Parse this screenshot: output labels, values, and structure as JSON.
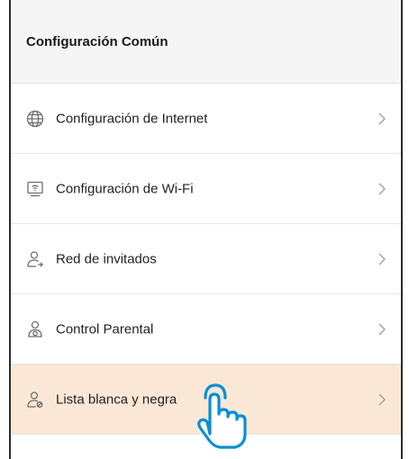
{
  "header": {
    "title": "Configuración Común"
  },
  "menu": {
    "items": [
      {
        "label": "Configuración de Internet",
        "icon": "globe-icon"
      },
      {
        "label": "Configuración de Wi-Fi",
        "icon": "wifi-monitor-icon"
      },
      {
        "label": "Red de invitados",
        "icon": "guest-user-icon"
      },
      {
        "label": "Control Parental",
        "icon": "parental-control-icon"
      },
      {
        "label": "Lista blanca y negra",
        "icon": "user-list-icon",
        "highlighted": true
      }
    ]
  },
  "annotation": {
    "icon": "tap-hand-icon",
    "color": "#0a8fd6"
  },
  "colors": {
    "highlight_background": "#fbe7d6",
    "header_background": "#f5f5f5",
    "icon_gray": "#6e6e6e"
  }
}
